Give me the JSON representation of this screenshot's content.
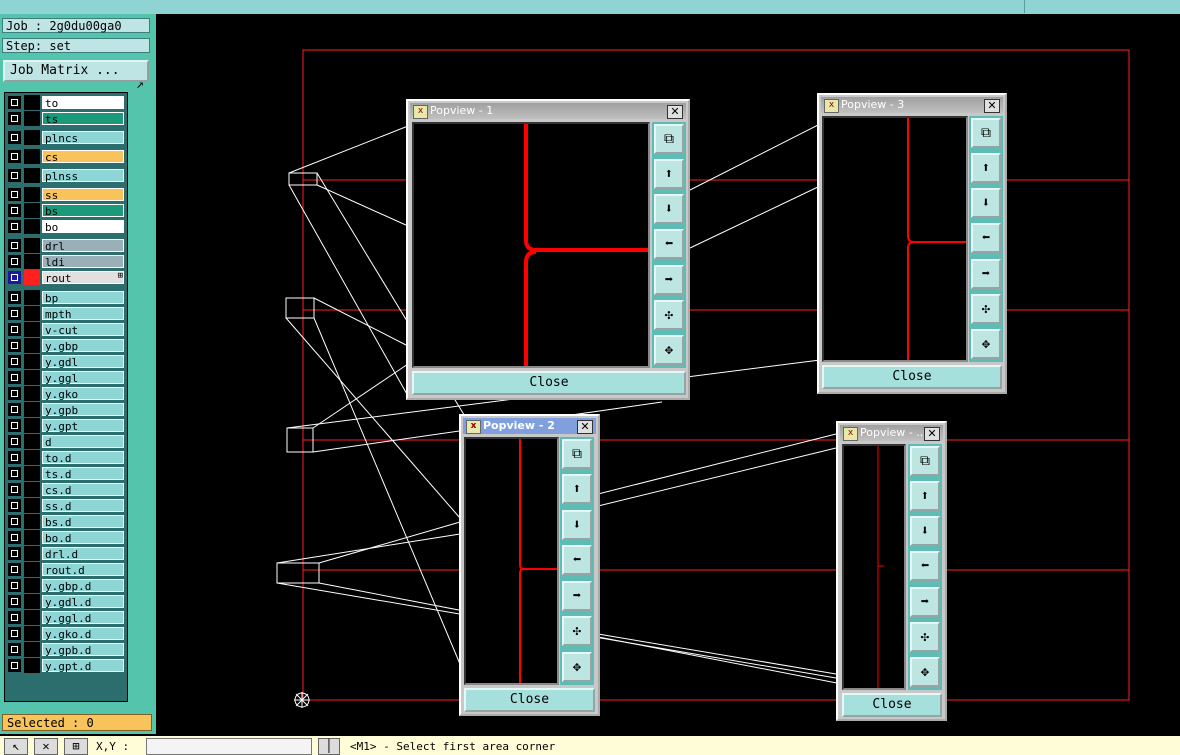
{
  "panel": {
    "job": "Job : 2g0du00ga0",
    "step": "Step: set",
    "job_matrix_button": "Job Matrix ...",
    "selected": "Selected : 0"
  },
  "layers": [
    {
      "name": "to",
      "color": "#000000",
      "fill": "#ffffff"
    },
    {
      "name": "ts",
      "color": "#000000",
      "fill": "#1a9a7a"
    },
    {
      "name": "plncs",
      "color": "#000000",
      "fill": "#8ed6d6"
    },
    {
      "name": "cs",
      "color": "#000000",
      "fill": "#f7c35a"
    },
    {
      "name": "plnss",
      "color": "#000000",
      "fill": "#8ed6d6"
    },
    {
      "name": "ss",
      "color": "#000000",
      "fill": "#f7c35a"
    },
    {
      "name": "bs",
      "color": "#000000",
      "fill": "#1a9a7a"
    },
    {
      "name": "bo",
      "color": "#000000",
      "fill": "#ffffff"
    },
    {
      "name": "drl",
      "color": "#000000",
      "fill": "#9ab0b8"
    },
    {
      "name": "ldi",
      "color": "#000000",
      "fill": "#9ab0b8"
    },
    {
      "name": "rout",
      "color": "#ff2020",
      "fill": "#e0e0e0",
      "active": true
    },
    {
      "name": "bp",
      "color": "#000000",
      "fill": "#8ed6d6"
    },
    {
      "name": "mpth",
      "color": "#000000",
      "fill": "#8ed6d6"
    },
    {
      "name": "v-cut",
      "color": "#000000",
      "fill": "#8ed6d6"
    },
    {
      "name": "y.gbp",
      "color": "#000000",
      "fill": "#8ed6d6"
    },
    {
      "name": "y.gdl",
      "color": "#000000",
      "fill": "#8ed6d6"
    },
    {
      "name": "y.ggl",
      "color": "#000000",
      "fill": "#8ed6d6"
    },
    {
      "name": "y.gko",
      "color": "#000000",
      "fill": "#8ed6d6"
    },
    {
      "name": "y.gpb",
      "color": "#000000",
      "fill": "#8ed6d6"
    },
    {
      "name": "y.gpt",
      "color": "#000000",
      "fill": "#8ed6d6"
    },
    {
      "name": "d",
      "color": "#000000",
      "fill": "#8ed6d6"
    },
    {
      "name": "to.d",
      "color": "#000000",
      "fill": "#8ed6d6"
    },
    {
      "name": "ts.d",
      "color": "#000000",
      "fill": "#8ed6d6"
    },
    {
      "name": "cs.d",
      "color": "#000000",
      "fill": "#8ed6d6"
    },
    {
      "name": "ss.d",
      "color": "#000000",
      "fill": "#8ed6d6"
    },
    {
      "name": "bs.d",
      "color": "#000000",
      "fill": "#8ed6d6"
    },
    {
      "name": "bo.d",
      "color": "#000000",
      "fill": "#8ed6d6"
    },
    {
      "name": "drl.d",
      "color": "#000000",
      "fill": "#8ed6d6"
    },
    {
      "name": "rout.d",
      "color": "#000000",
      "fill": "#8ed6d6"
    },
    {
      "name": "y.gbp.d",
      "color": "#000000",
      "fill": "#8ed6d6"
    },
    {
      "name": "y.gdl.d",
      "color": "#000000",
      "fill": "#8ed6d6"
    },
    {
      "name": "y.ggl.d",
      "color": "#000000",
      "fill": "#8ed6d6"
    },
    {
      "name": "y.gko.d",
      "color": "#000000",
      "fill": "#8ed6d6"
    },
    {
      "name": "y.gpb.d",
      "color": "#000000",
      "fill": "#8ed6d6"
    },
    {
      "name": "y.gpt.d",
      "color": "#000000",
      "fill": "#8ed6d6"
    }
  ],
  "popviews": [
    {
      "title": "Popview - 1",
      "close": "Close"
    },
    {
      "title": "Popview - 2",
      "close": "Close"
    },
    {
      "title": "Popview - 3",
      "close": "Close"
    },
    {
      "title": "Popview - ...",
      "close": "Close"
    }
  ],
  "popview_tools": [
    "zoom-fit-icon",
    "pan-up-icon",
    "pan-down-icon",
    "pan-left-icon",
    "pan-right-icon",
    "zoom-in-icon",
    "zoom-out-icon"
  ],
  "status": {
    "xy_label": "X,Y :",
    "xy_value": "",
    "message": "<M1> - Select first area corner"
  },
  "colors": {
    "outline": "#ff2020",
    "trace": "#ff0000",
    "accent": "#54c4ac"
  }
}
